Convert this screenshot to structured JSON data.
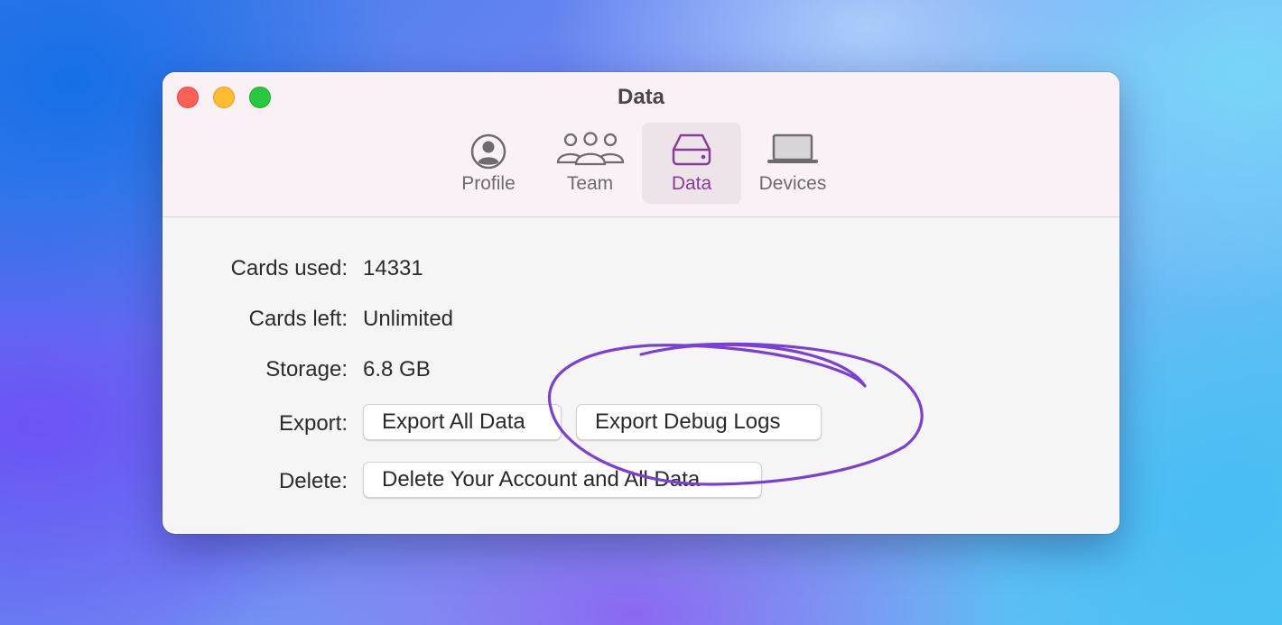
{
  "window": {
    "title": "Data"
  },
  "tabs": [
    {
      "label": "Profile",
      "icon": "person-circle-icon",
      "active": false
    },
    {
      "label": "Team",
      "icon": "team-icon",
      "active": false
    },
    {
      "label": "Data",
      "icon": "drive-icon",
      "active": true
    },
    {
      "label": "Devices",
      "icon": "laptop-icon",
      "active": false
    }
  ],
  "rows": {
    "cards_used": {
      "label": "Cards used:",
      "value": "14331"
    },
    "cards_left": {
      "label": "Cards left:",
      "value": "Unlimited"
    },
    "storage": {
      "label": "Storage:",
      "value": "6.8 GB"
    },
    "export": {
      "label": "Export:",
      "buttons": [
        "Export All Data",
        "Export Debug Logs"
      ]
    },
    "delete": {
      "label": "Delete:",
      "button": "Delete Your Account and All Data"
    }
  },
  "colors": {
    "accent": "#8a3b9a",
    "annotation_stroke": "#7b3fd6",
    "titlebar": "#f9f1f5",
    "content": "#f6f5f6"
  }
}
